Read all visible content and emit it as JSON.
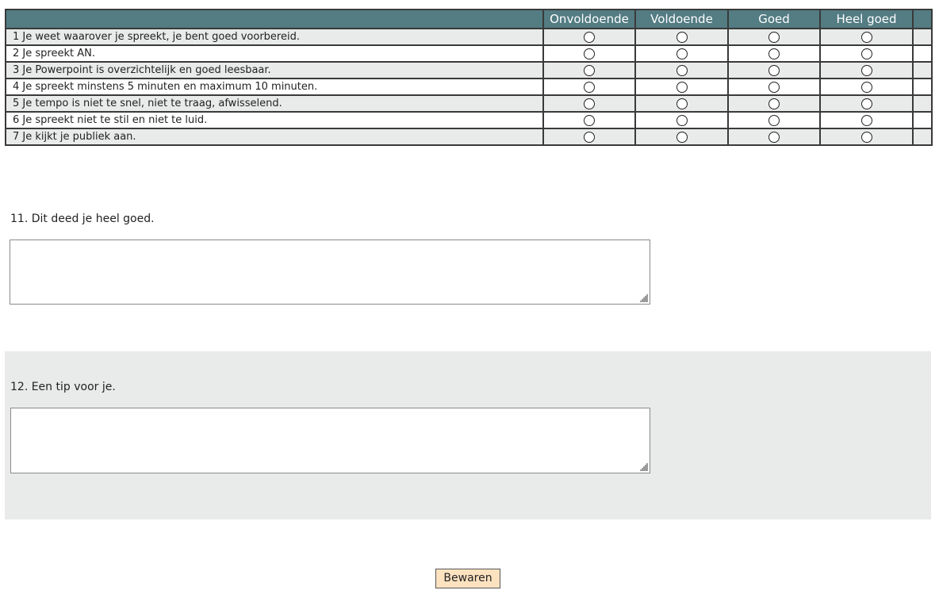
{
  "matrix": {
    "columns": [
      "Onvoldoende",
      "Voldoende",
      "Goed",
      "Heel goed"
    ],
    "rows": [
      "1 Je weet waarover je spreekt, je bent goed voorbereid.",
      "2 Je spreekt AN.",
      "3 Je Powerpoint is overzichtelijk en goed leesbaar.",
      "4 Je spreekt minstens 5 minuten en maximum 10 minuten.",
      "5 Je tempo is niet te snel, niet te traag, afwisselend.",
      "6 Je spreekt niet te stil en niet te luid.",
      "7 Je kijkt je publiek aan."
    ]
  },
  "q11": {
    "label": "11. Dit deed je heel goed.",
    "value": ""
  },
  "q12": {
    "label": "12. Een tip voor je.",
    "value": ""
  },
  "save_button": {
    "label": "Bewaren"
  },
  "colors": {
    "header_bg": "#537c83",
    "row_alt_bg": "#e8ebea",
    "button_bg": "#fde2c0"
  }
}
